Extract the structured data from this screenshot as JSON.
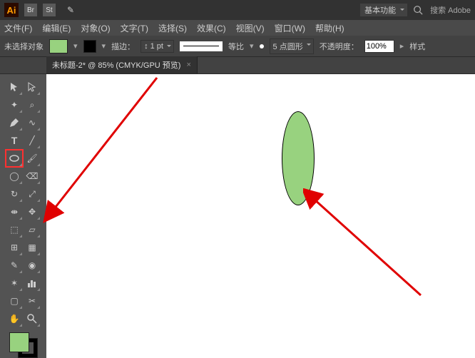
{
  "titlebar": {
    "app": "Ai",
    "sc1": "Br",
    "sc2": "St",
    "workspace": "基本功能",
    "search": "搜索 Adobe"
  },
  "menu": {
    "file": "文件(F)",
    "edit": "编辑(E)",
    "object": "对象(O)",
    "type": "文字(T)",
    "select": "选择(S)",
    "effect": "效果(C)",
    "view": "视图(V)",
    "window": "窗口(W)",
    "help": "帮助(H)"
  },
  "control": {
    "noselection": "未选择对象",
    "stroke_label": "描边：",
    "stroke_weight": "1 pt",
    "dash_label": "等比",
    "profile": "5 点圆形",
    "opacity_label": "不透明度：",
    "opacity_value": "100%",
    "style": "样式"
  },
  "doc": {
    "title": "未标题-2* @ 85% (CMYK/GPU 预览)"
  },
  "chart_data": null
}
